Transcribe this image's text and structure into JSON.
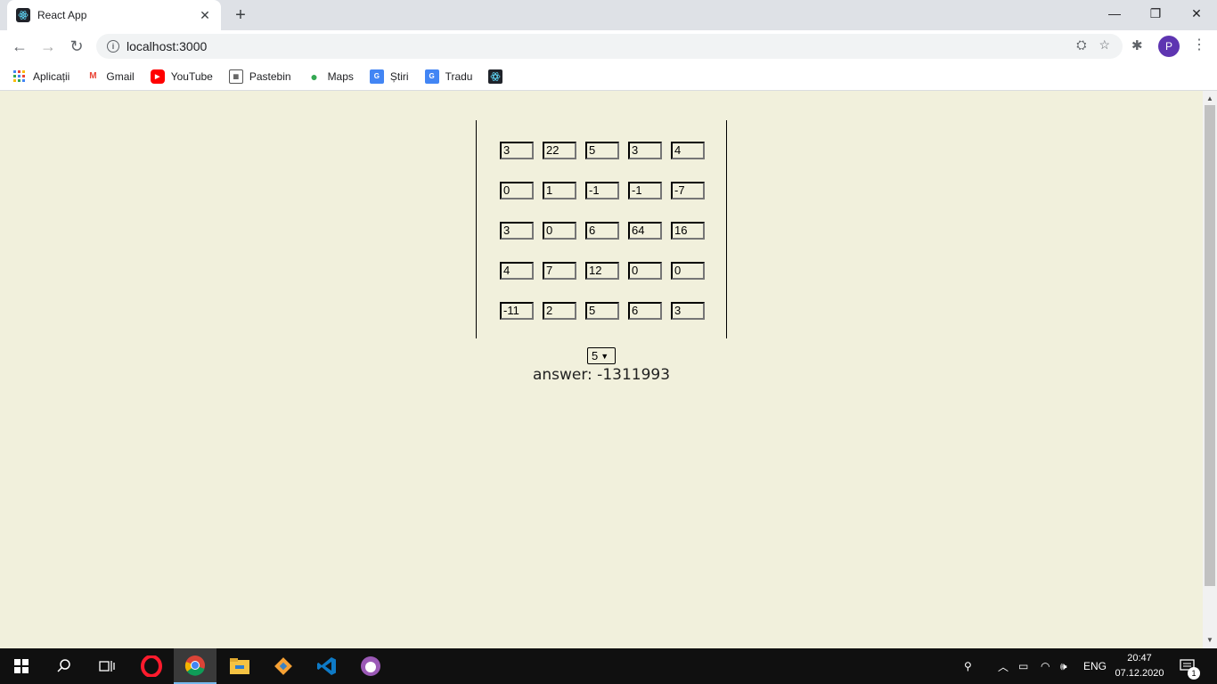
{
  "browser": {
    "tab_title": "React App",
    "url": "localhost:3000",
    "profile_initial": "P",
    "bookmarks": [
      {
        "label": "Aplicații",
        "icon": "apps-grid-icon"
      },
      {
        "label": "Gmail",
        "icon": "gmail-icon"
      },
      {
        "label": "YouTube",
        "icon": "youtube-icon"
      },
      {
        "label": "Pastebin",
        "icon": "pastebin-icon"
      },
      {
        "label": "Maps",
        "icon": "maps-icon"
      },
      {
        "label": "Știri",
        "icon": "news-icon"
      },
      {
        "label": "Tradu",
        "icon": "translate-icon"
      },
      {
        "label": "",
        "icon": "react-icon"
      }
    ]
  },
  "matrix": {
    "rows": [
      [
        "3",
        "22",
        "5",
        "3",
        "4"
      ],
      [
        "0",
        "1",
        "-1",
        "-1",
        "-7"
      ],
      [
        "3",
        "0",
        "6",
        "64",
        "16"
      ],
      [
        "4",
        "7",
        "12",
        "0",
        "0"
      ],
      [
        "-11",
        "2",
        "5",
        "6",
        "3"
      ]
    ],
    "size_value": "5",
    "answer": "answer: -1311993"
  },
  "taskbar": {
    "apps": [
      "windows-start-icon",
      "search-icon",
      "task-view-icon",
      "opera-icon",
      "chrome-icon",
      "file-explorer-icon",
      "git-icon",
      "vscode-icon",
      "app-icon"
    ],
    "language": "ENG",
    "time": "20:47",
    "date": "07.12.2020",
    "notification_count": "1"
  }
}
